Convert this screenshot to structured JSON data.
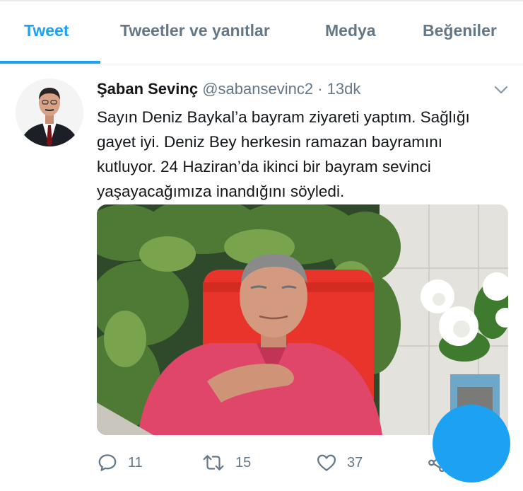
{
  "tabs": [
    {
      "label": "Tweet"
    },
    {
      "label": "Tweetler ve yanıtlar"
    },
    {
      "label": "Medya"
    },
    {
      "label": "Beğeniler"
    }
  ],
  "tweet": {
    "author_name": "Şaban Sevinç",
    "handle": "@sabansevinc2",
    "separator": "·",
    "time": "13dk",
    "text_lines": [
      "Sayın Deniz Baykal’a bayram ziyareti yaptım. Sağlığı",
      "gayet iyi. Deniz Bey herkesin ramazan bayramını",
      "kutluyor. 24 Haziran’da ikinci bir bayram sevinci",
      "yaşayacağımıza inandığını söyledi."
    ],
    "replies": "11",
    "retweets": "15",
    "likes": "37"
  },
  "colors": {
    "accent": "#1da1f2",
    "muted": "#657786",
    "text": "#14171a"
  },
  "icons": [
    "chevron-down-icon",
    "reply-icon",
    "retweet-icon",
    "like-icon",
    "share-icon"
  ]
}
